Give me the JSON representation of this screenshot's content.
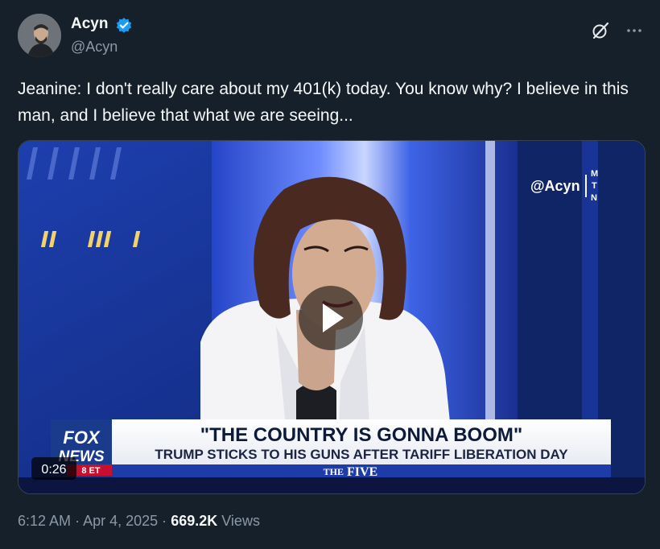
{
  "author": {
    "name": "Acyn",
    "handle": "@Acyn"
  },
  "tweet": {
    "text": "Jeanine: I don't really care about my 401(k) today. You know why? I believe in this man, and I believe that what we are seeing..."
  },
  "video": {
    "duration": "0:26",
    "watermark": "@Acyn",
    "watermark_logo": "MTN",
    "headline": "\"THE COUNTRY IS GONNA BOOM\"",
    "subheadline": "TRUMP STICKS TO HIS GUNS AFTER TARIFF LIBERATION DAY",
    "show_prefix": "THE",
    "show_name": "FIVE",
    "network_top": "FOX",
    "network_bottom": "NEWS",
    "timezone_badge": "8 ET"
  },
  "meta": {
    "time": "6:12 AM",
    "separator": "·",
    "date": "Apr 4, 2025",
    "views_count": "669.2K",
    "views_label": "Views"
  },
  "icons": {
    "verified": "verified-badge-icon",
    "grok": "grok-icon",
    "more": "more-options-icon",
    "play": "play-icon"
  },
  "colors": {
    "background": "#15202b",
    "verified_blue": "#1d9bf0",
    "muted_text": "#8b98a5",
    "fox_red": "#c8102e",
    "fox_blue": "#1a3a8c"
  }
}
